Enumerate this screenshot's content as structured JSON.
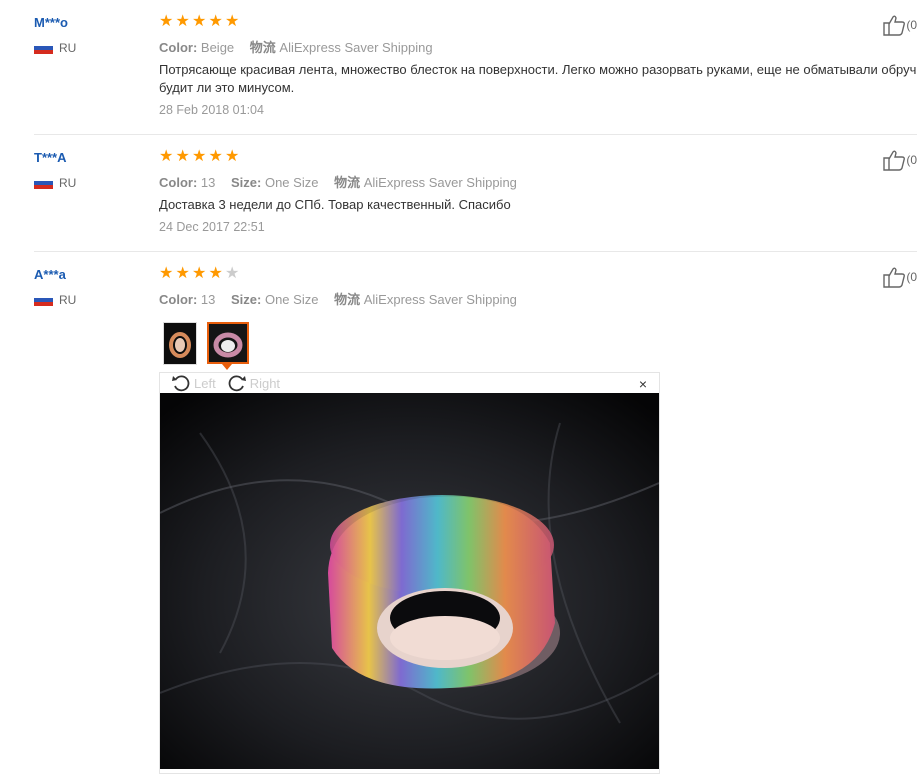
{
  "reviews": [
    {
      "user": "M***o",
      "country": "RU",
      "rating": 5,
      "attributes": [
        {
          "key": "Color:",
          "value": "Beige"
        }
      ],
      "logistics_key": "物流",
      "logistics_value": "AliExpress Saver Shipping",
      "content": "Потрясающе красивая лента, множество блесток на поверхности. Легко можно разорвать руками, еще не обматывали обруч будит ли это минусом.",
      "date": "28 Feb 2018 01:04",
      "helpful": "(0"
    },
    {
      "user": "T***A",
      "country": "RU",
      "rating": 5,
      "attributes": [
        {
          "key": "Color:",
          "value": "13"
        },
        {
          "key": "Size:",
          "value": "One Size"
        }
      ],
      "logistics_key": "物流",
      "logistics_value": "AliExpress Saver Shipping",
      "content": "Доставка 3 недели до СПб. Товар качественный. Спасибо",
      "date": "24 Dec 2017 22:51",
      "helpful": "(0"
    },
    {
      "user": "A***a",
      "country": "RU",
      "rating": 4,
      "attributes": [
        {
          "key": "Color:",
          "value": "13"
        },
        {
          "key": "Size:",
          "value": "One Size"
        }
      ],
      "logistics_key": "物流",
      "logistics_value": "AliExpress Saver Shipping",
      "helpful": "(0"
    }
  ],
  "viewer": {
    "rotate_left": "Left",
    "rotate_right": "Right",
    "close_glyph": "×",
    "selected_thumbnail": 2
  },
  "colors": {
    "star": "#ff9900",
    "username": "#1b5bb1",
    "selected_border": "#e85e0c"
  }
}
